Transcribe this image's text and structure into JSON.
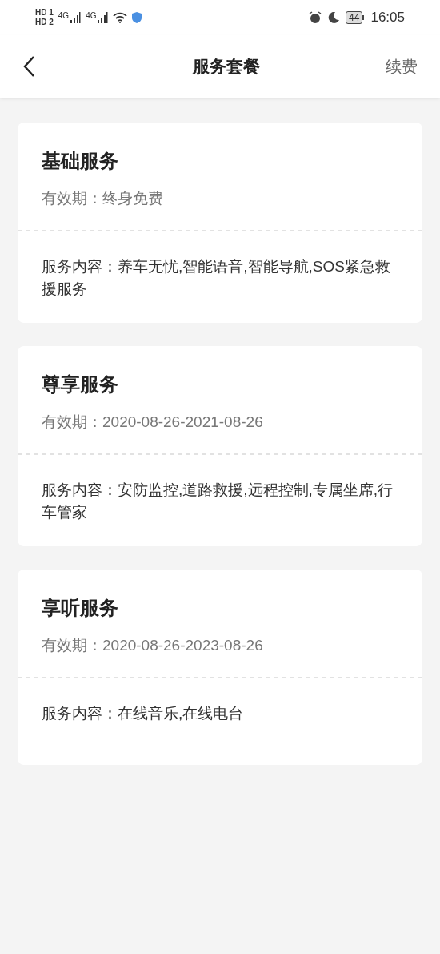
{
  "status_bar": {
    "sim_labels": [
      "HD 1",
      "HD 2"
    ],
    "network_labels": [
      "4G",
      "4G"
    ],
    "battery": "44",
    "time": "16:05"
  },
  "header": {
    "title": "服务套餐",
    "action": "续费"
  },
  "packages": [
    {
      "name": "基础服务",
      "validity": "有效期：终身免费",
      "content": "服务内容：养车无忧,智能语音,智能导航,SOS紧急救援服务"
    },
    {
      "name": "尊享服务",
      "validity": "有效期：2020-08-26-2021-08-26",
      "content": "服务内容：安防监控,道路救援,远程控制,专属坐席,行车管家"
    },
    {
      "name": "享听服务",
      "validity": "有效期：2020-08-26-2023-08-26",
      "content": "服务内容：在线音乐,在线电台"
    }
  ]
}
